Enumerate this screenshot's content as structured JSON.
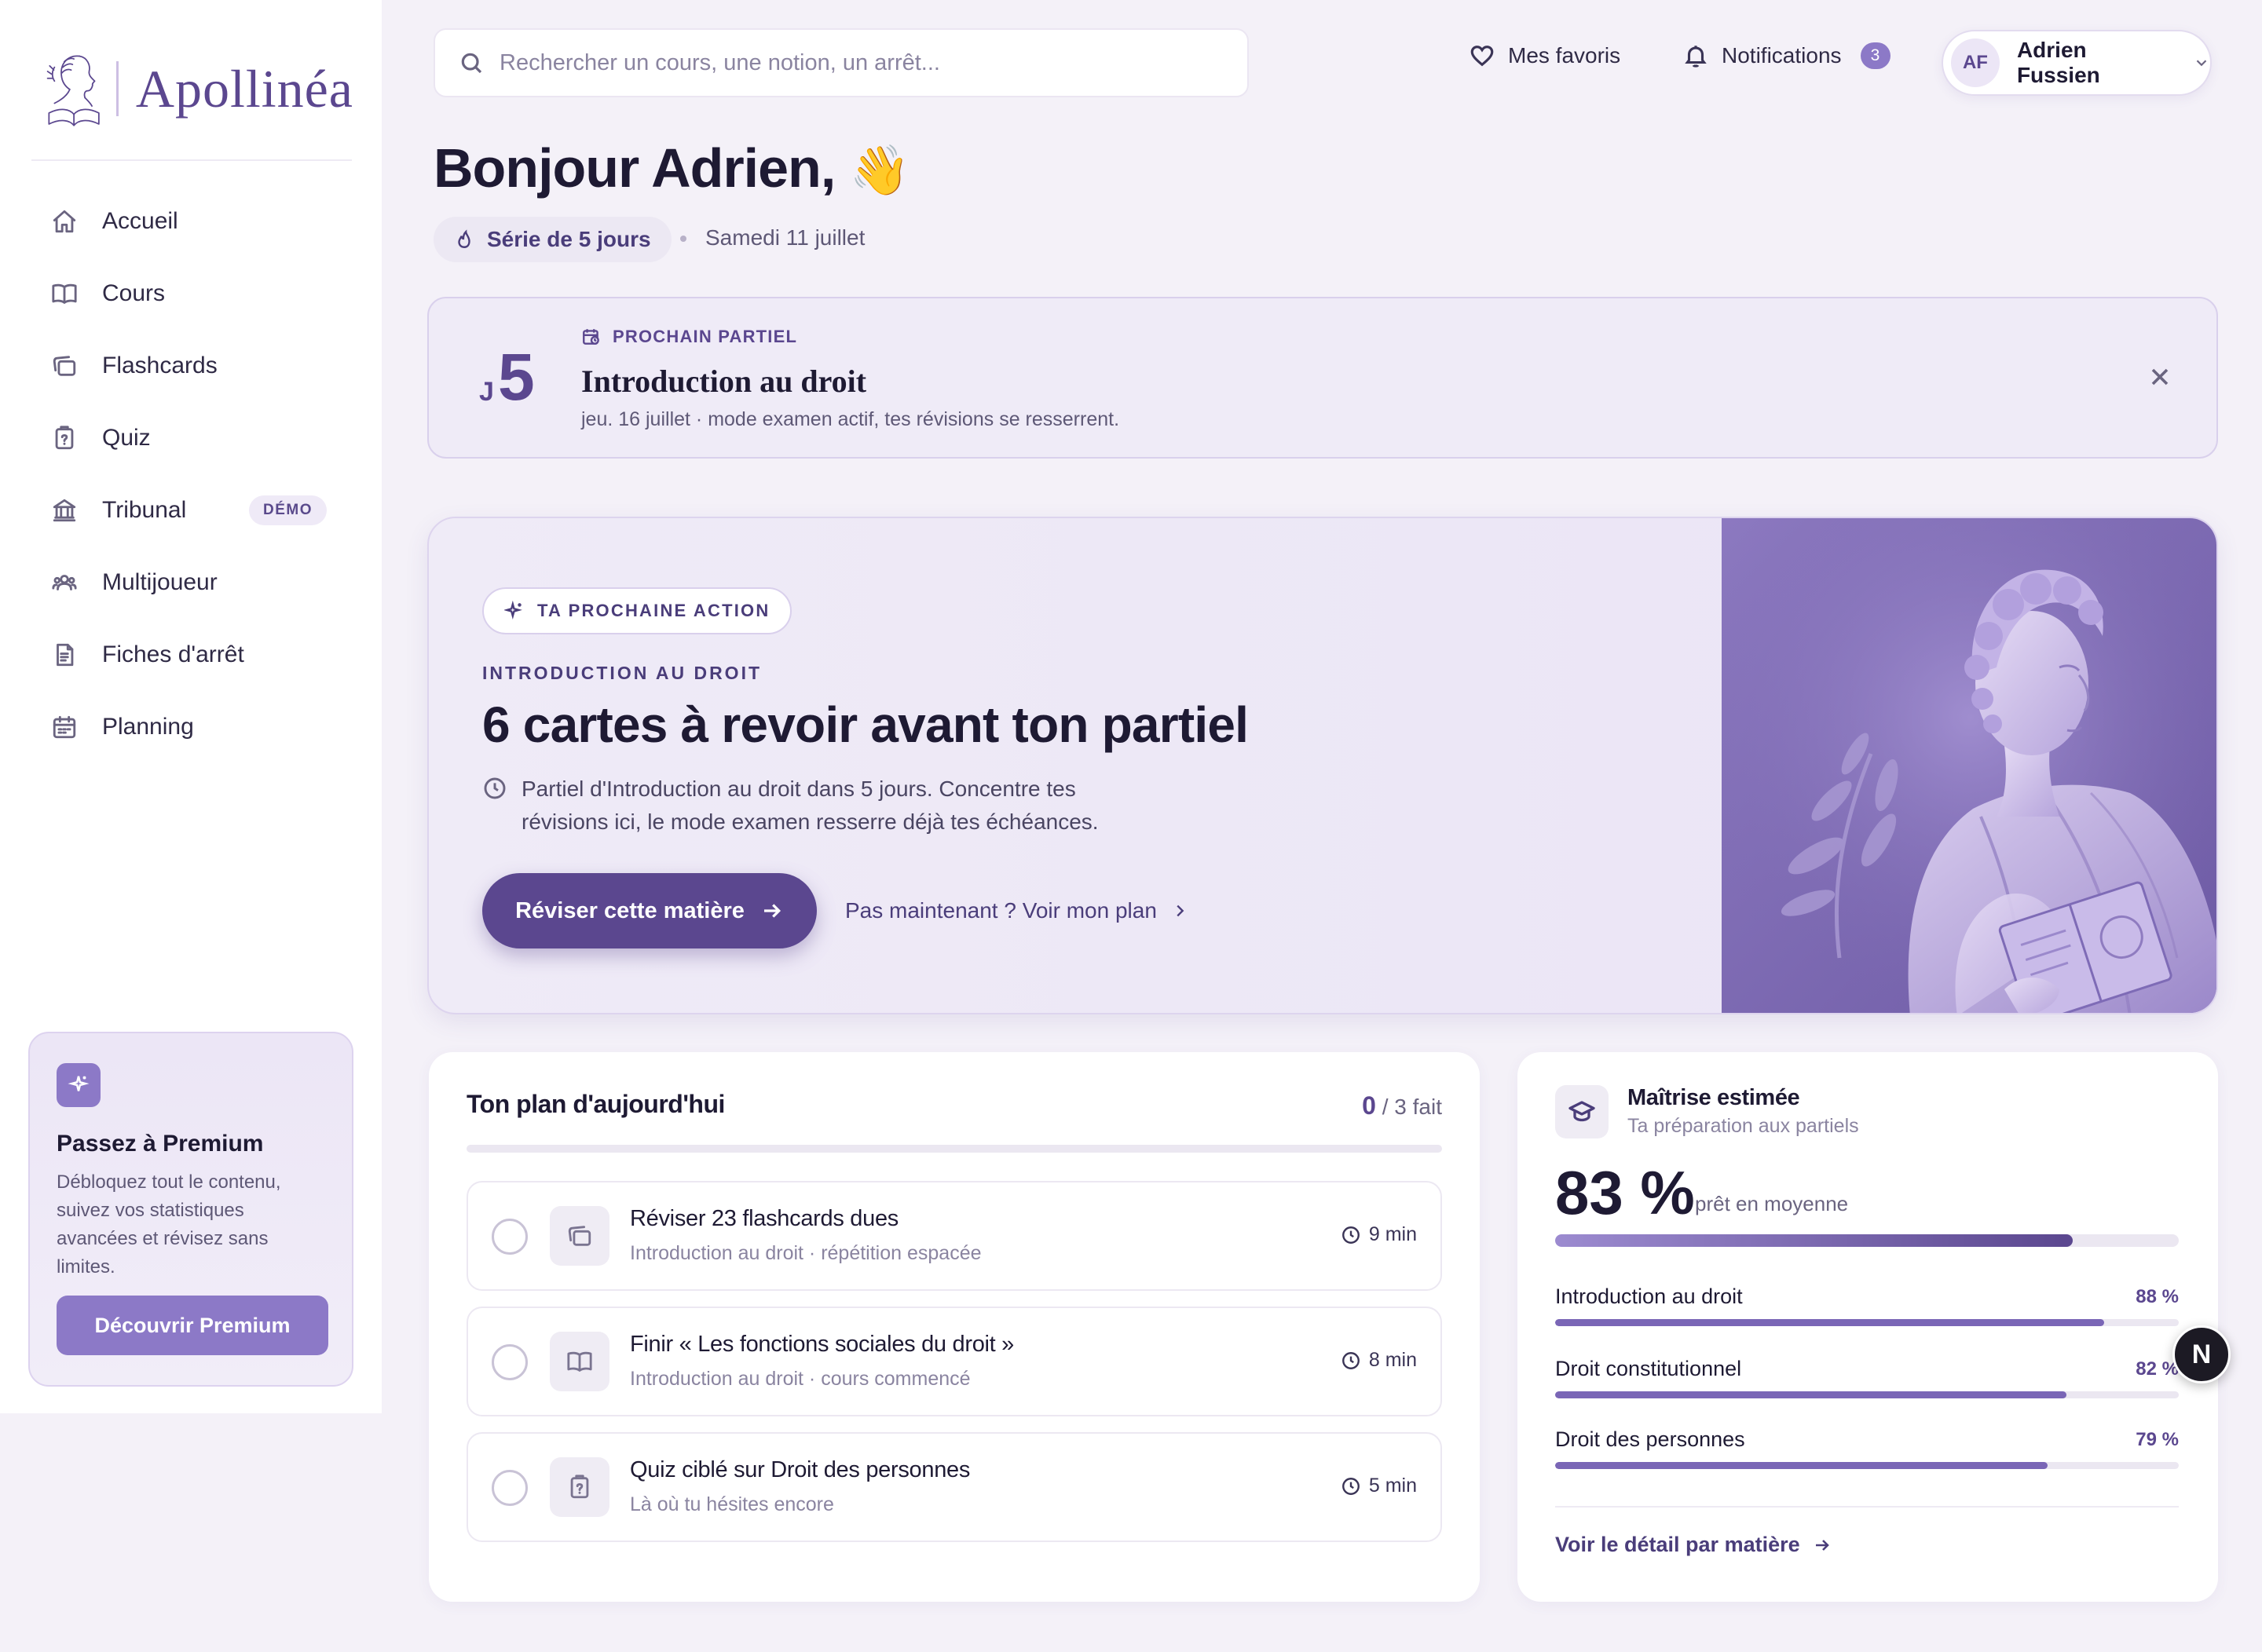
{
  "brand": {
    "name": "Apollinéa",
    "icon": "apollo-logo-icon"
  },
  "sidebar": {
    "items": [
      {
        "label": "Accueil",
        "icon": "home-icon"
      },
      {
        "label": "Cours",
        "icon": "book-icon"
      },
      {
        "label": "Flashcards",
        "icon": "flashcards-icon"
      },
      {
        "label": "Quiz",
        "icon": "quiz-icon"
      },
      {
        "label": "Tribunal",
        "icon": "courthouse-icon",
        "badge": "DÉMO"
      },
      {
        "label": "Multijoueur",
        "icon": "users-icon"
      },
      {
        "label": "Fiches d'arrêt",
        "icon": "document-icon"
      },
      {
        "label": "Planning",
        "icon": "calendar-icon"
      }
    ],
    "premium": {
      "title": "Passez à Premium",
      "text": "Débloquez tout le contenu, suivez vos statistiques avancées et révisez sans limites.",
      "button": "Découvrir Premium",
      "icon": "sparkles-icon"
    }
  },
  "topbar": {
    "search_placeholder": "Rechercher un cours, une notion, un arrêt...",
    "favorites": "Mes favoris",
    "notifications": "Notifications",
    "notifications_count": "3",
    "user_initials": "AF",
    "user_name": "Adrien Fussien"
  },
  "greeting": {
    "title": "Bonjour Adrien,",
    "emoji": "👋",
    "streak": "Série de 5 jours",
    "date": "Samedi 11 juillet"
  },
  "exam": {
    "countdown_prefix": "J",
    "countdown_value": "5",
    "eyebrow": "PROCHAIN PARTIEL",
    "title": "Introduction au droit",
    "subtitle": "jeu. 16 juillet · mode examen actif, tes révisions se resserrent."
  },
  "hero": {
    "pill": "TA PROCHAINE ACTION",
    "eyebrow": "INTRODUCTION AU DROIT",
    "title": "6 cartes à revoir avant ton partiel",
    "description": "Partiel d'Introduction au droit dans 5 jours. Concentre tes révisions ici, le mode examen resserre déjà tes échéances.",
    "cta": "Réviser cette matière",
    "secondary": "Pas maintenant ? Voir mon plan"
  },
  "plan": {
    "title": "Ton plan d'aujourd'hui",
    "done": "0",
    "total_label": "/ 3 fait",
    "progress": 0,
    "tasks": [
      {
        "title": "Réviser 23 flashcards dues",
        "subtitle": "Introduction au droit · répétition espacée",
        "time": "9 min",
        "icon": "flashcards-icon"
      },
      {
        "title": "Finir « Les fonctions sociales du droit »",
        "subtitle": "Introduction au droit · cours commencé",
        "time": "8 min",
        "icon": "book-icon"
      },
      {
        "title": "Quiz ciblé sur Droit des personnes",
        "subtitle": "Là où tu hésites encore",
        "time": "5 min",
        "icon": "quiz-icon"
      }
    ]
  },
  "mastery": {
    "title": "Maîtrise estimée",
    "subtitle": "Ta préparation aux partiels",
    "value": "83 %",
    "value_num": 83,
    "caption": "prêt en moyenne",
    "subjects": [
      {
        "name": "Introduction au droit",
        "pct": "88 %",
        "value": 88
      },
      {
        "name": "Droit constitutionnel",
        "pct": "82 %",
        "value": 82
      },
      {
        "name": "Droit des personnes",
        "pct": "79 %",
        "value": 79
      }
    ],
    "link": "Voir le détail par matière"
  },
  "dev_badge": "N"
}
